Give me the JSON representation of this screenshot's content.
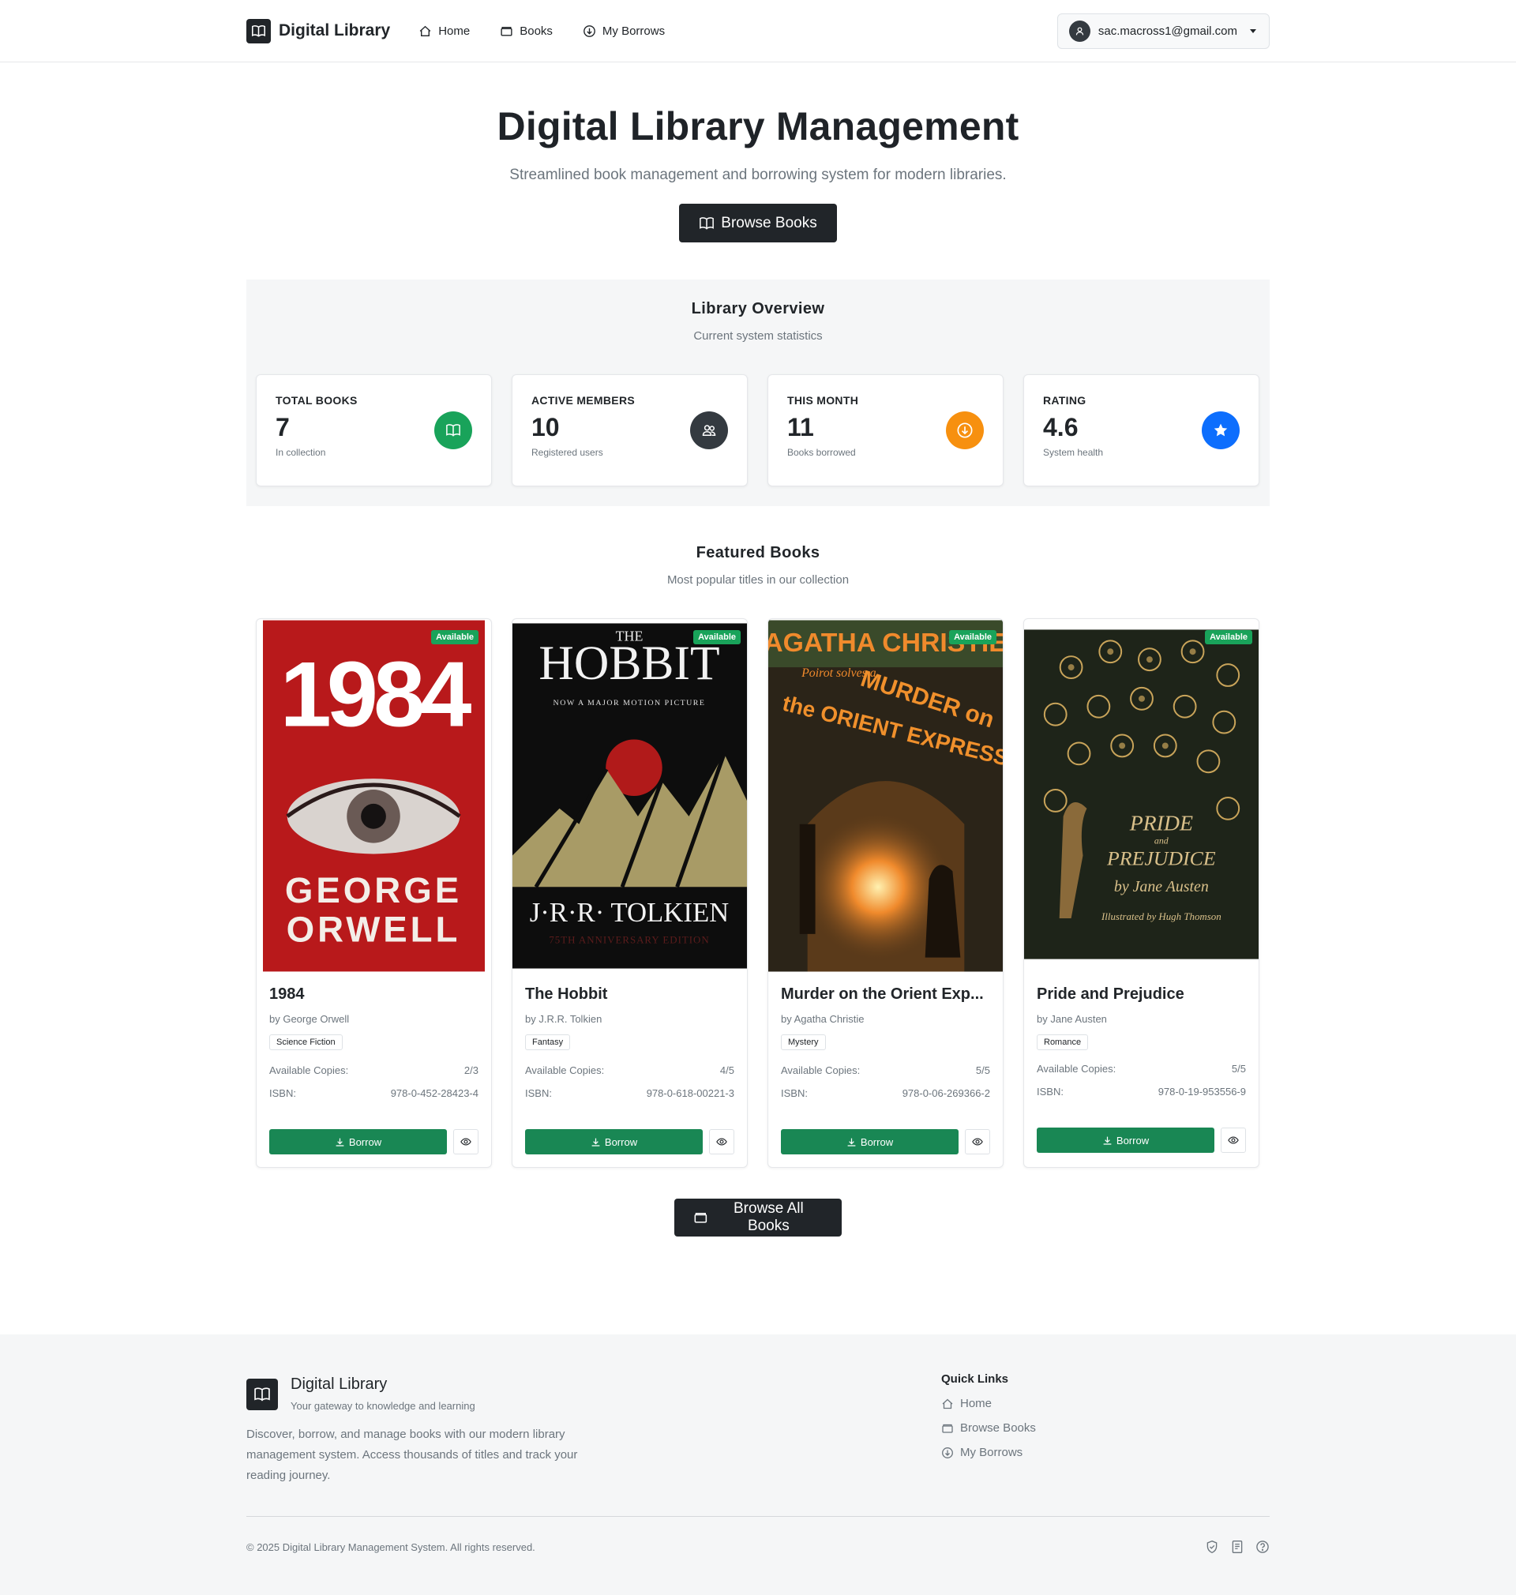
{
  "nav": {
    "brand": "Digital Library",
    "links": [
      {
        "label": "Home",
        "icon": "house-icon"
      },
      {
        "label": "Books",
        "icon": "archive-icon"
      },
      {
        "label": "My Borrows",
        "icon": "download-circle-icon"
      }
    ],
    "user_email": "sac.macross1@gmail.com"
  },
  "hero": {
    "title": "Digital Library Management",
    "subtitle": "Streamlined book management and borrowing system for modern libraries.",
    "button": "Browse Books"
  },
  "overview": {
    "title": "Library Overview",
    "subtitle": "Current system statistics",
    "stats": [
      {
        "label": "TOTAL BOOKS",
        "value": "7",
        "hint": "In collection",
        "icon": "book-icon",
        "color": "#19a35a"
      },
      {
        "label": "ACTIVE MEMBERS",
        "value": "10",
        "hint": "Registered users",
        "icon": "people-icon",
        "color": "#343a40"
      },
      {
        "label": "THIS MONTH",
        "value": "11",
        "hint": "Books borrowed",
        "icon": "download-circle-icon",
        "color": "#f7900f"
      },
      {
        "label": "RATING",
        "value": "4.6",
        "hint": "System health",
        "icon": "star-icon",
        "color": "#0d6efd"
      }
    ]
  },
  "featured": {
    "title": "Featured Books",
    "subtitle": "Most popular titles in our collection",
    "available_label": "Available",
    "copies_label": "Available Copies:",
    "isbn_label": "ISBN:",
    "borrow_label": "Borrow",
    "books": [
      {
        "title": "1984",
        "author": "by George Orwell",
        "genre": "Science Fiction",
        "copies": "2/3",
        "isbn": "978-0-452-28423-4",
        "cover": {
          "bg": "#b8191b",
          "top": "1984",
          "bottom1": "GEORGE",
          "bottom2": "ORWELL"
        }
      },
      {
        "title": "The Hobbit",
        "author": "by J.R.R. Tolkien",
        "genre": "Fantasy",
        "copies": "4/5",
        "isbn": "978-0-618-00221-3",
        "cover": {
          "bg": "#0d0d0d",
          "top": "THE",
          "mid": "HOBBIT",
          "tag": "NOW A MAJOR MOTION PICTURE",
          "bottom1": "J·R·R· TOLKIEN",
          "bottom2": "75TH ANNIVERSARY EDITION"
        }
      },
      {
        "title": "Murder on the Orient Exp...",
        "author": "by Agatha Christie",
        "genre": "Mystery",
        "copies": "5/5",
        "isbn": "978-0-06-269366-2",
        "cover": {
          "bg": "#2b2418",
          "top": "AGATHA CHRISTIE",
          "mid": "Poirot solves a",
          "bottom1": "MURDER on",
          "bottom2": "the ORIENT EXPRESS"
        }
      },
      {
        "title": "Pride and Prejudice",
        "author": "by Jane Austen",
        "genre": "Romance",
        "copies": "5/5",
        "isbn": "978-0-19-953556-9",
        "cover": {
          "bg": "#1e2419",
          "top": "PRIDE",
          "mid": "and",
          "bottom1": "PREJUDICE",
          "bottom2": "by Jane Austen",
          "tag": "Illustrated by Hugh Thomson"
        }
      }
    ],
    "browse_all": "Browse All Books"
  },
  "footer": {
    "name": "Digital Library",
    "tagline": "Your gateway to knowledge and learning",
    "description": "Discover, borrow, and manage books with our modern library management system. Access thousands of titles and track your reading journey.",
    "quick_title": "Quick Links",
    "quick_links": [
      {
        "label": "Home",
        "icon": "house-icon"
      },
      {
        "label": "Browse Books",
        "icon": "archive-icon"
      },
      {
        "label": "My Borrows",
        "icon": "download-circle-icon"
      }
    ],
    "copyright": "© 2025 Digital Library Management System. All rights reserved.",
    "icons": [
      "shield-icon",
      "document-icon",
      "help-icon"
    ]
  }
}
